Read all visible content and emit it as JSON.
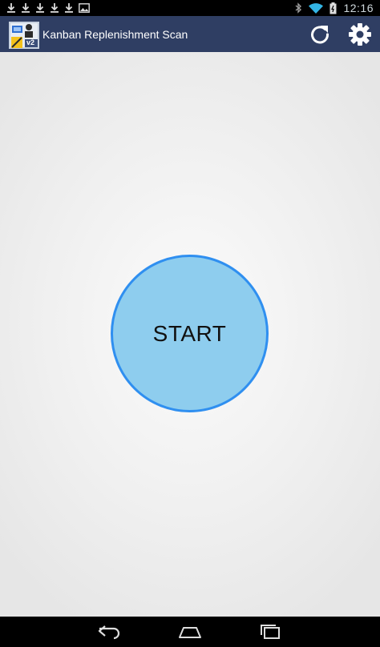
{
  "status_bar": {
    "time": "12:16",
    "notification_icons": [
      "download-icon",
      "download-icon",
      "download-icon",
      "download-icon",
      "download-icon",
      "image-icon"
    ],
    "system_icons": [
      "bluetooth-icon",
      "wifi-icon",
      "battery-icon"
    ]
  },
  "action_bar": {
    "title": "Kanban Replenishment Scan",
    "logo_badge": "v2",
    "background_color": "#2f3e63",
    "actions": [
      {
        "icon": "refresh-icon"
      },
      {
        "icon": "gear-icon"
      }
    ]
  },
  "main": {
    "start_label": "START",
    "button_fill_color": "#8ecdee",
    "button_border_color": "#2f8ff0"
  },
  "nav_bar": {
    "buttons": [
      {
        "icon": "back-icon"
      },
      {
        "icon": "home-icon"
      },
      {
        "icon": "recent-apps-icon"
      }
    ]
  }
}
